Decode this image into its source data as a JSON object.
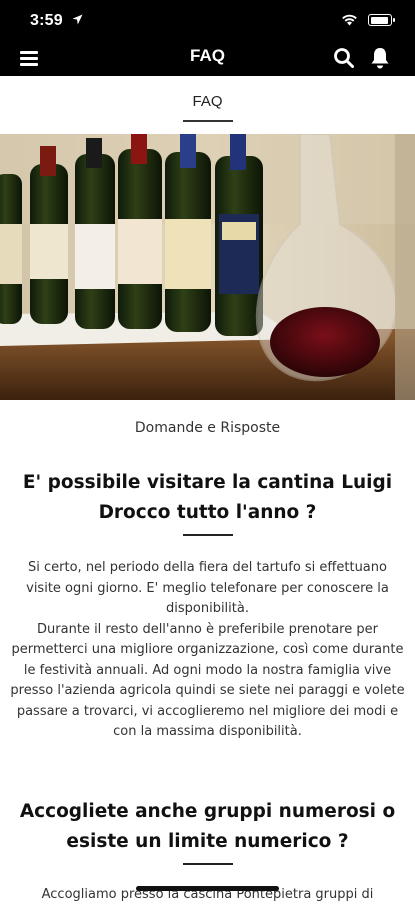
{
  "status": {
    "time": "3:59"
  },
  "header": {
    "title": "FAQ"
  },
  "section": {
    "tab": "FAQ"
  },
  "page": {
    "subtitle": "Domande e Risposte",
    "faq": [
      {
        "question": "E' possibile visitare la cantina Luigi Drocco tutto l'anno ?",
        "answer": "Si certo, nel periodo della fiera del tartufo si effettuano visite ogni giorno. E' meglio telefonare per conoscere la disponibilità.\nDurante il resto dell'anno è preferibile prenotare per permetterci una migliore organizzazione, così come durante le festività annuali. Ad ogni modo la nostra famiglia vive presso l'azienda agricola quindi se siete nei paraggi e volete passare a trovarci, vi accoglieremo nel migliore dei modi e con la massima disponibilità."
      },
      {
        "question": "Accogliete anche gruppi numerosi o esiste un limite numerico ?",
        "answer": "Accogliamo presso la cascina Pontepietra gruppi di"
      }
    ]
  },
  "colors": {
    "bar": "#000000",
    "text": "#222222"
  }
}
